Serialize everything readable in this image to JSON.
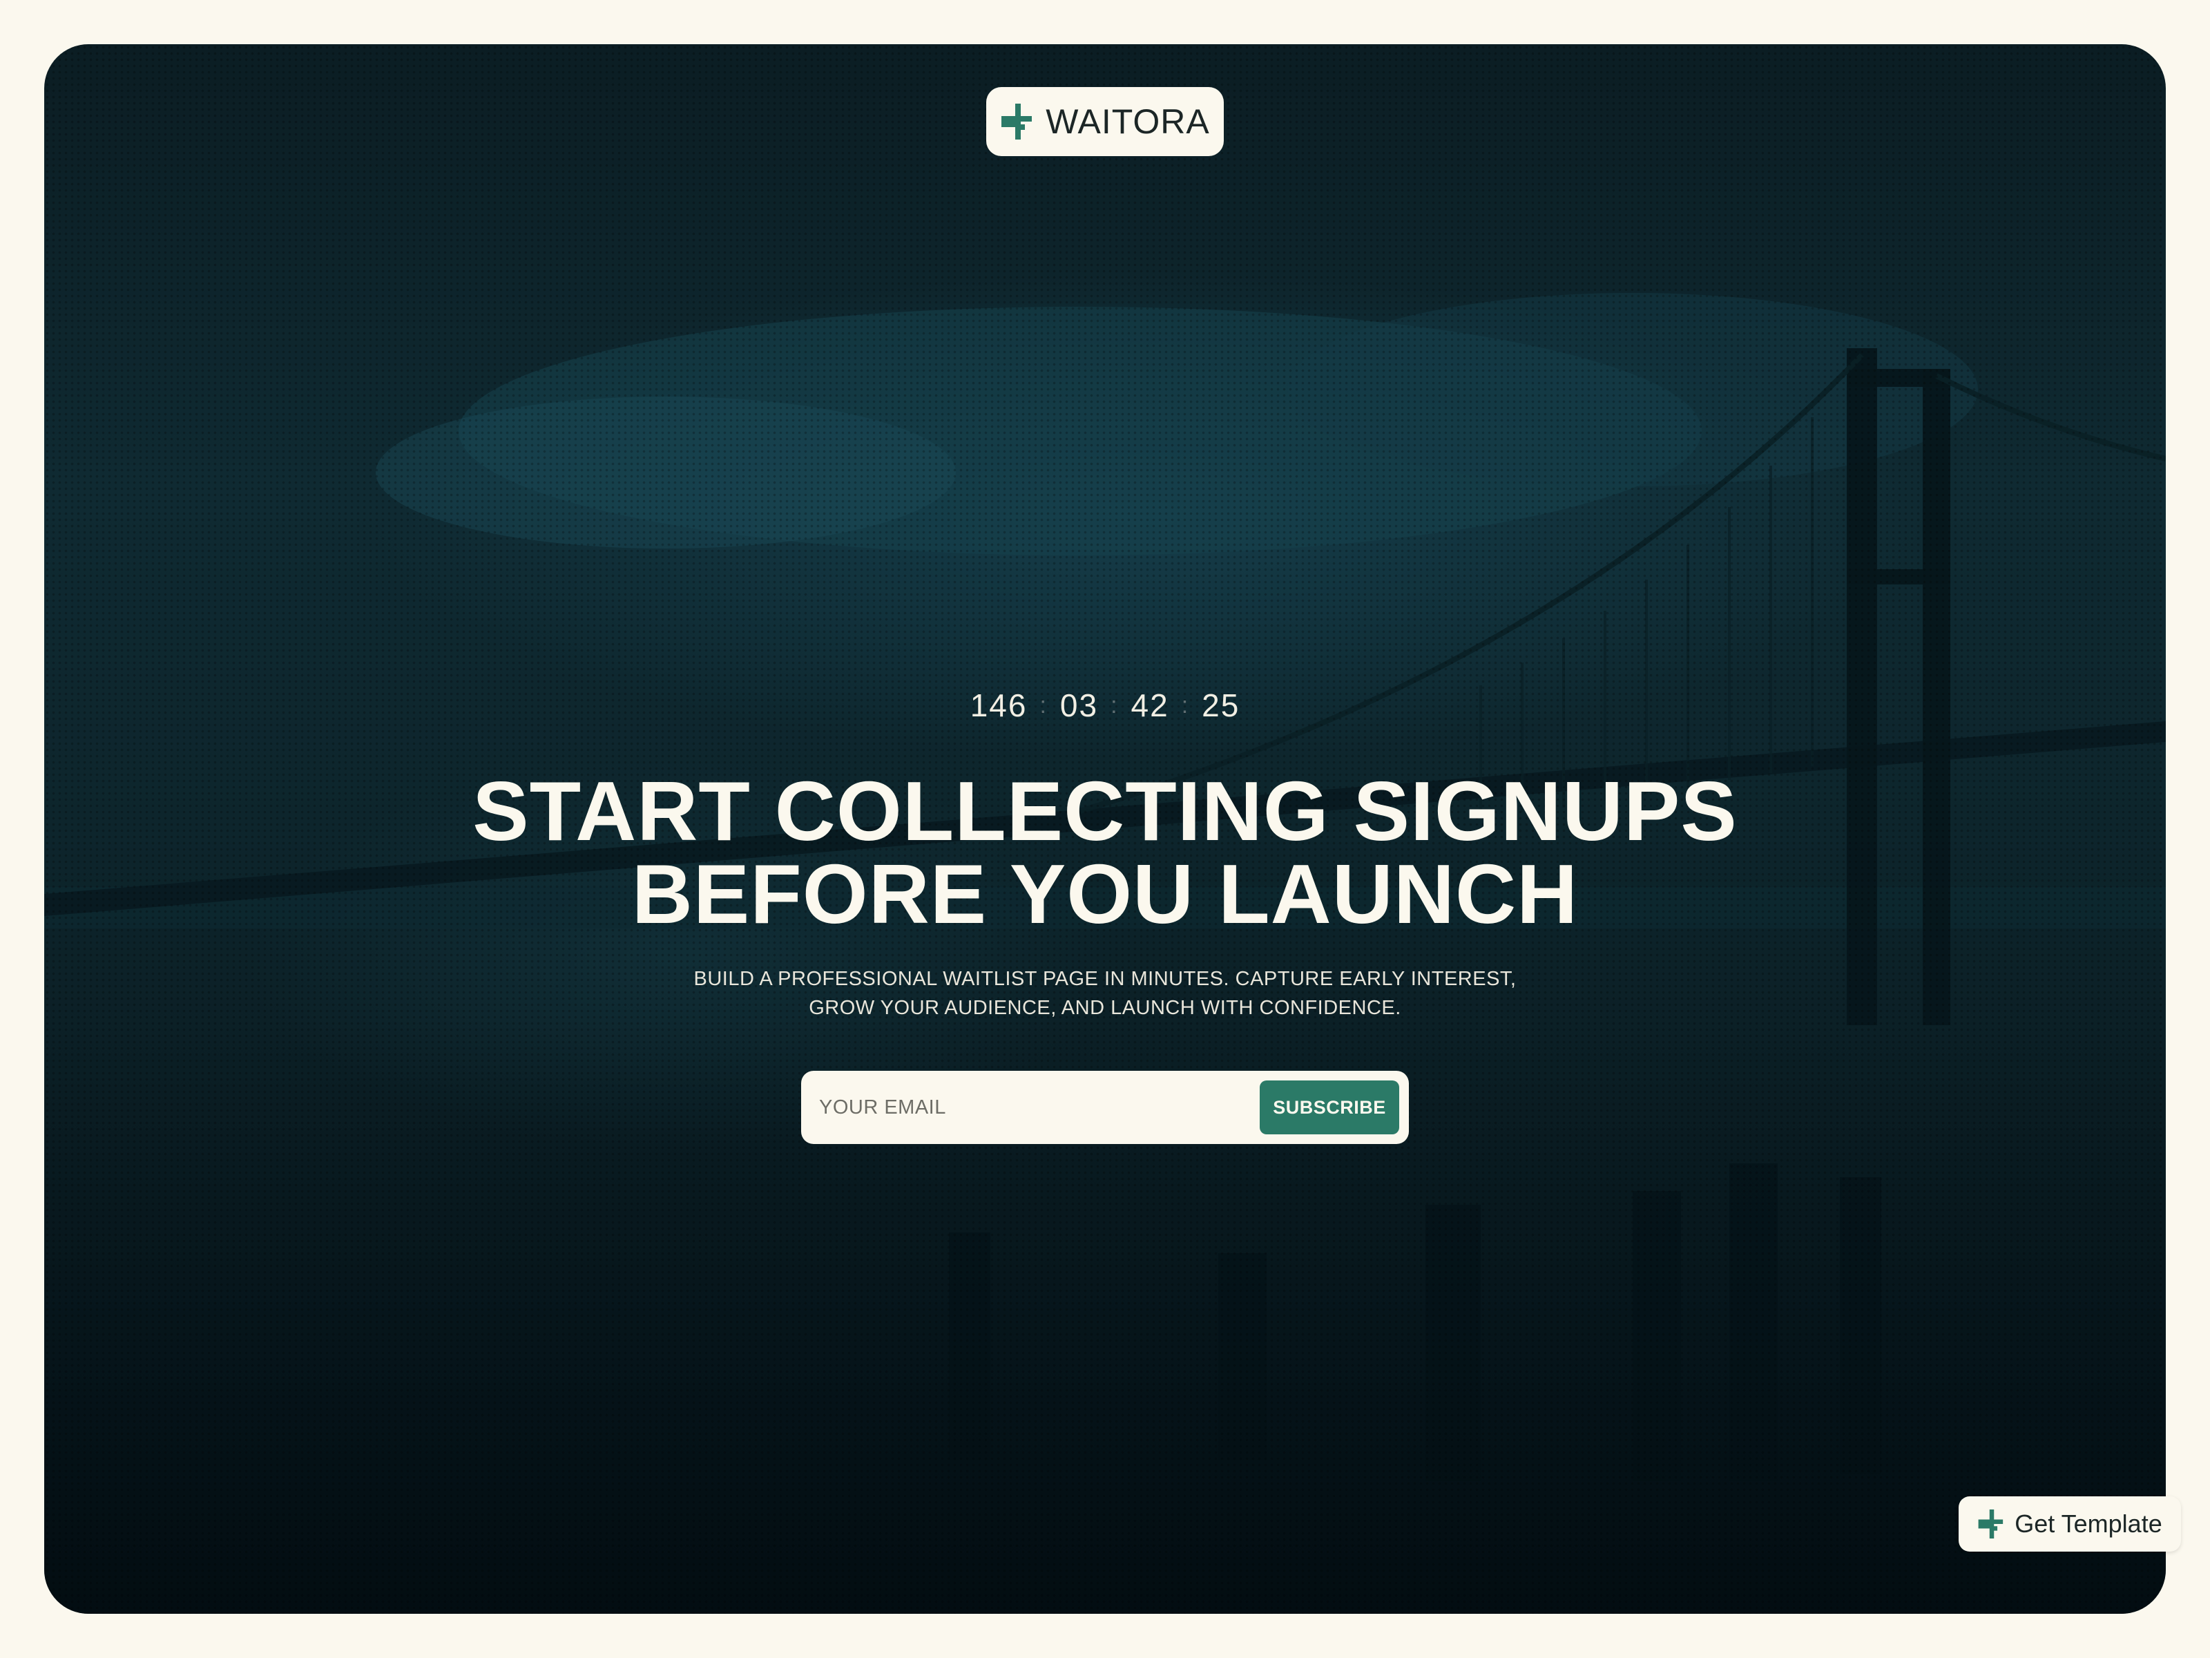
{
  "brand": {
    "name": "WAITORA",
    "logo_icon": "cross-plus-logo",
    "accent_color": "#2b7a67"
  },
  "countdown": {
    "days": "146",
    "hours": "03",
    "minutes": "42",
    "seconds": "25",
    "separator": ":"
  },
  "hero": {
    "headline_line1": "START COLLECTING SIGNUPS",
    "headline_line2": "BEFORE YOU LAUNCH",
    "subtext_line1": "BUILD A PROFESSIONAL WAITLIST PAGE IN MINUTES. CAPTURE EARLY INTEREST,",
    "subtext_line2": "GROW YOUR AUDIENCE, AND LAUNCH WITH CONFIDENCE.",
    "background": "dark-teal-bridge-photo"
  },
  "signup": {
    "email_placeholder": "YOUR EMAIL",
    "email_value": "",
    "button_label": "SUBSCRIBE"
  },
  "floating": {
    "get_template_label": "Get Template"
  },
  "colors": {
    "page_background": "#fbf8ee",
    "hero_dark": "#0b1d23",
    "text_light": "#fbf8ee",
    "button": "#2b7a67"
  }
}
